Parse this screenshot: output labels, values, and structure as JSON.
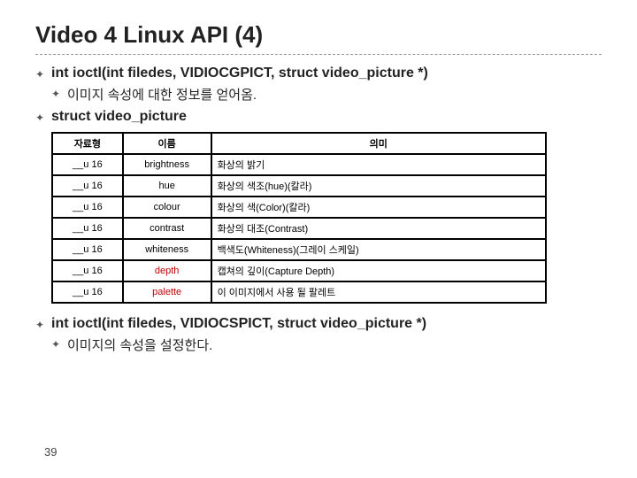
{
  "title": "Video 4 Linux API (4)",
  "b1": {
    "main": "int ioctl(int filedes, VIDIOCGPICT, struct video_picture *)",
    "sub": "이미지 속성에 대한 정보를 얻어옴."
  },
  "b2": {
    "main": "struct video_picture"
  },
  "table": {
    "h0": "자료형",
    "h1": "이름",
    "h2": "의미",
    "rows": [
      {
        "t": "__u 16",
        "n": "brightness",
        "d": "화상의 밝기"
      },
      {
        "t": "__u 16",
        "n": "hue",
        "d": "화상의 색조(hue)(칼라)"
      },
      {
        "t": "__u 16",
        "n": "colour",
        "d": "화상의 색(Color)(칼라)"
      },
      {
        "t": "__u 16",
        "n": "contrast",
        "d": "화상의 대조(Contrast)"
      },
      {
        "t": "__u 16",
        "n": "whiteness",
        "d": "백색도(Whiteness)(그레이 스케일)"
      },
      {
        "t": "__u 16",
        "n": "depth",
        "d": "캡쳐의 깊이(Capture Depth)",
        "red": true
      },
      {
        "t": "__u 16",
        "n": "palette",
        "d": "이 이미지에서 사용 될 팔레트",
        "red": true
      }
    ]
  },
  "b3": {
    "main": "int ioctl(int filedes, VIDIOCSPICT, struct video_picture *)",
    "sub": "이미지의 속성을 설정한다."
  },
  "page": "39"
}
